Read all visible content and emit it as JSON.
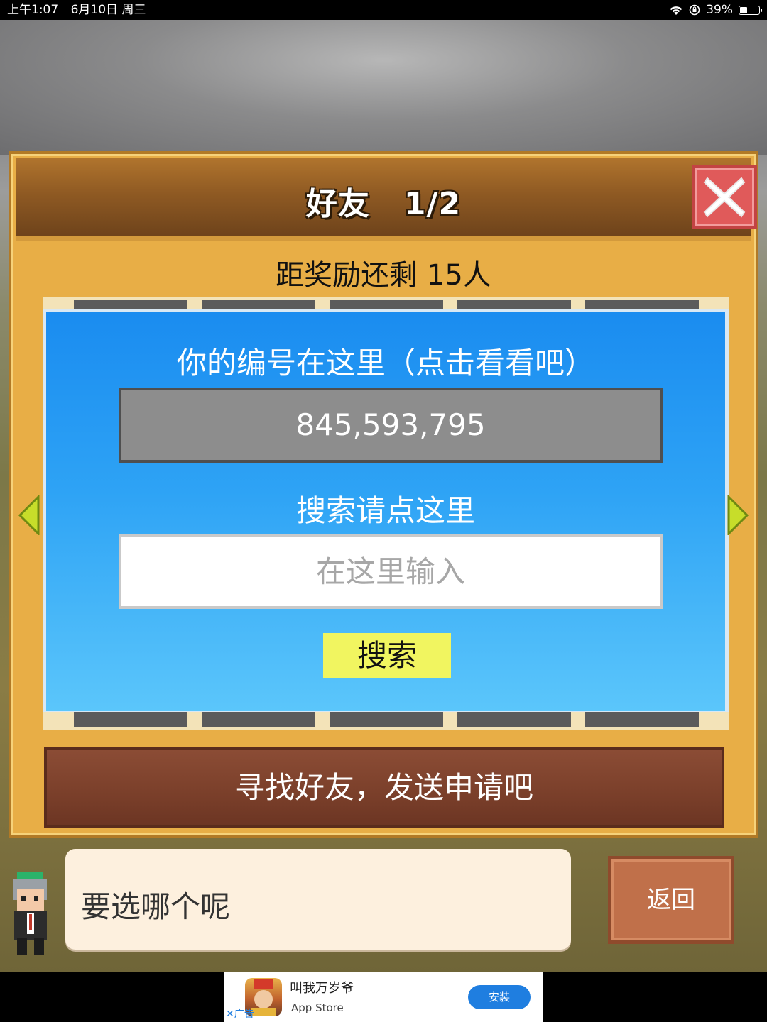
{
  "status_bar": {
    "time": "上午1:07",
    "date": "6月10日 周三",
    "battery": "39%"
  },
  "panel": {
    "title": "好友",
    "page": "1/2",
    "reward_text": "距奖励还剩 15人"
  },
  "dialog": {
    "id_label": "你的编号在这里（点击看看吧）",
    "id_value": "845,593,795",
    "search_label": "搜索请点这里",
    "search_placeholder": "在这里输入",
    "search_button": "搜索"
  },
  "send_bar": {
    "label": "寻找好友，发送申请吧"
  },
  "speech": {
    "text": "要选哪个呢"
  },
  "back_button": {
    "label": "返回"
  },
  "ad": {
    "title": "叫我万岁爷",
    "source": "App Store",
    "install": "安装",
    "tag": "✕广告"
  },
  "colors": {
    "panel_bg": "#e8ae46",
    "dialog_top": "#1a8cf0",
    "dialog_bottom": "#5bc6fb",
    "search_button": "#f1f560",
    "close_button": "#e05a5a",
    "install_button": "#1f7ee0"
  }
}
